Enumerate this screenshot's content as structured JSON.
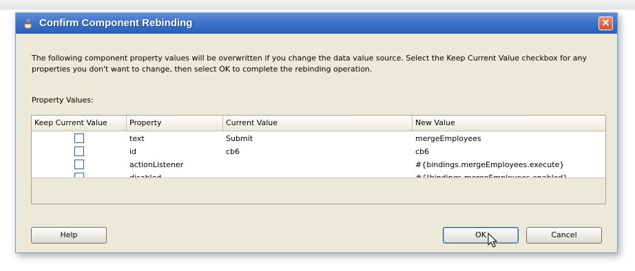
{
  "dialog": {
    "title": "Confirm Component Rebinding",
    "close_glyph": "✕",
    "description": "The following component property values will be overwritten if you change the data value source. Select the Keep Current Value checkbox for any properties you don't want to change, then select OK to complete the rebinding operation.",
    "section_label": "Property Values:"
  },
  "table": {
    "columns": [
      "Keep Current Value",
      "Property",
      "Current Value",
      "New Value"
    ],
    "rows": [
      {
        "property": "text",
        "current": "Submit",
        "new": "mergeEmployees",
        "keep": false
      },
      {
        "property": "id",
        "current": "cb6",
        "new": "cb6",
        "keep": false
      },
      {
        "property": "actionListener",
        "current": "",
        "new": "#{bindings.mergeEmployees.execute}",
        "keep": false
      },
      {
        "property": "disabled",
        "current": "",
        "new": "#{!bindings.mergeEmployees.enabled}",
        "keep": false
      }
    ]
  },
  "buttons": {
    "help": "Help",
    "ok": "OK",
    "cancel": "Cancel"
  },
  "icons": {
    "title": "java-cup-icon",
    "close": "close-icon",
    "cursor": "mouse-pointer-icon"
  },
  "colors": {
    "titlebar": "#3a6fc7",
    "close": "#d64f2a",
    "dialog_bg": "#ece9d8"
  }
}
